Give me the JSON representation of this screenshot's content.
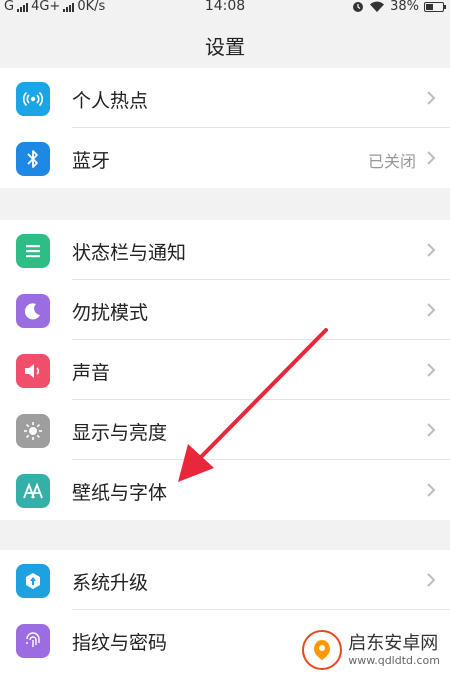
{
  "status_bar": {
    "carrier1": "G",
    "carrier2": "4G+",
    "speed": "0K/s",
    "time": "14:08",
    "battery": "38%"
  },
  "header": {
    "title": "设置"
  },
  "groups": [
    {
      "items": [
        {
          "label": "个人热点",
          "value": "",
          "icon": "hotspot-icon",
          "color": "#1aa6e6"
        },
        {
          "label": "蓝牙",
          "value": "已关闭",
          "icon": "bluetooth-icon",
          "color": "#1e88e5"
        }
      ]
    },
    {
      "items": [
        {
          "label": "状态栏与通知",
          "value": "",
          "icon": "notification-icon",
          "color": "#2ebd85"
        },
        {
          "label": "勿扰模式",
          "value": "",
          "icon": "moon-icon",
          "color": "#9b6de0"
        },
        {
          "label": "声音",
          "value": "",
          "icon": "speaker-icon",
          "color": "#f04e6a"
        },
        {
          "label": "显示与亮度",
          "value": "",
          "icon": "brightness-icon",
          "color": "#9e9e9e"
        },
        {
          "label": "壁纸与字体",
          "value": "",
          "icon": "font-icon",
          "color": "#33b0a8"
        }
      ]
    },
    {
      "items": [
        {
          "label": "系统升级",
          "value": "",
          "icon": "upgrade-icon",
          "color": "#1ea1e0"
        },
        {
          "label": "指纹与密码",
          "value": "",
          "icon": "fingerprint-icon",
          "color": "#9b6de0"
        }
      ]
    }
  ],
  "watermark": {
    "title": "启东安卓网",
    "subtitle": "www.qdldtd.com"
  },
  "colors": {
    "accent_arrow": "#e8273a",
    "background": "#f2f2f2"
  }
}
